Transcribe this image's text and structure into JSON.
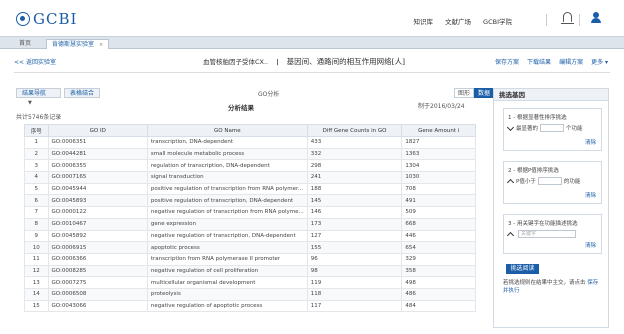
{
  "app": {
    "logo_text": "GCBI"
  },
  "topnav": [
    "知识库",
    "文献广场",
    "GCBI学院"
  ],
  "tabs": {
    "home": "首页",
    "active": "肯德斯慧实验室",
    "close": "×"
  },
  "header": {
    "back": "<< 返回实验室",
    "title_a": "血管核舶因子受体CX..",
    "title_sep": "|",
    "title_b": "基因间、通路间的相互作用网络[人]"
  },
  "actions": [
    "保存方案",
    "下载结果",
    "编辑方案",
    "更多 ▾"
  ],
  "controls": {
    "nav_label": "结果导航",
    "dropdown_caret": "▼",
    "results_table": "表格结合",
    "go_label": "GO分析",
    "view_chart": "图形",
    "view_data": "数据"
  },
  "analysis": {
    "title": "分析结果",
    "made_date": "制于2016/03/24",
    "count": "共计5746条记录"
  },
  "table": {
    "headers": [
      "序号",
      "GO ID",
      "GO Name",
      "Diff Gene Counts in GO",
      "Gene Amount i"
    ],
    "rows": [
      [
        "1",
        "GO:0006351",
        "transcription, DNA-dependent",
        "433",
        "1827"
      ],
      [
        "2",
        "GO:0044281",
        "small molecule metabolic process",
        "332",
        "1363"
      ],
      [
        "3",
        "GO:0006355",
        "regulation of transcription, DNA-dependent",
        "298",
        "1304"
      ],
      [
        "4",
        "GO:0007165",
        "signal transduction",
        "241",
        "1030"
      ],
      [
        "5",
        "GO:0045944",
        "positive regulation of transcription from RNA polymer...",
        "188",
        "708"
      ],
      [
        "6",
        "GO:0045893",
        "positive regulation of transcription, DNA-dependent",
        "145",
        "491"
      ],
      [
        "7",
        "GO:0000122",
        "negative regulation of transcription from RNA polyme...",
        "146",
        "509"
      ],
      [
        "8",
        "GO:0010467",
        "gene expression",
        "173",
        "668"
      ],
      [
        "9",
        "GO:0045892",
        "negative regulation of transcription, DNA-dependent",
        "127",
        "446"
      ],
      [
        "10",
        "GO:0006915",
        "apoptotic process",
        "155",
        "654"
      ],
      [
        "11",
        "GO:0006366",
        "transcription from RNA polymerase II promoter",
        "96",
        "329"
      ],
      [
        "12",
        "GO:0008285",
        "negative regulation of cell proliferation",
        "98",
        "358"
      ],
      [
        "13",
        "GO:0007275",
        "multicellular organismal development",
        "119",
        "498"
      ],
      [
        "14",
        "GO:0006508",
        "proteolysis",
        "118",
        "486"
      ],
      [
        "15",
        "GO:0043066",
        "negative regulation of apoptotic process",
        "117",
        "484"
      ]
    ]
  },
  "panel": {
    "title": "挑选基因",
    "f1": {
      "title": "1 - 根据显著性排序挑选",
      "prefix": "最显著的",
      "suffix": "个功能",
      "clear": "清除"
    },
    "f2": {
      "title": "2 - 根据P值排序挑选",
      "prefix": "P值小于",
      "suffix": "的功能",
      "clear": "清除"
    },
    "f3": {
      "title": "3 - 用关键字在功能描述挑选",
      "placeholder": "关键字",
      "clear": "清除"
    },
    "submit": "挑选阅读",
    "hint": "若挑选规则在结果中主交，请点击",
    "hint_link": "保存并执行"
  },
  "colors": {
    "accent": "#1b5ea8",
    "header_bg": "#eef2f6"
  }
}
